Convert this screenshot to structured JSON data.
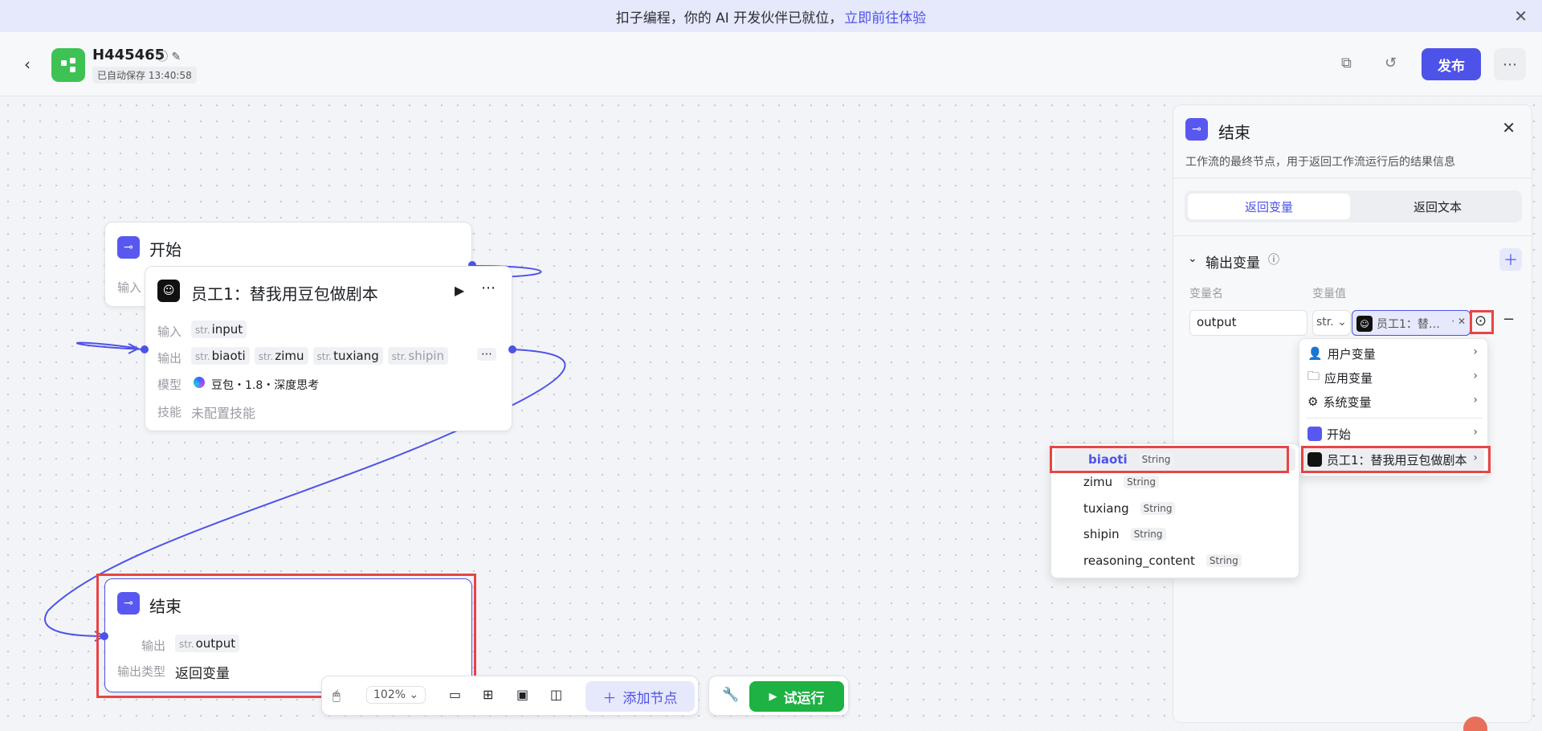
{
  "banner": {
    "text": "扣子编程，你的 AI 开发伙伴已就位，",
    "link": "立即前往体验"
  },
  "header": {
    "title": "H445465",
    "saved": "已自动保存 13:40:58",
    "publish": "发布"
  },
  "nodes": {
    "start": {
      "title": "开始",
      "input_label": "输入"
    },
    "employee": {
      "title": "员工1：替我用豆包做剧本",
      "input_label": "输入",
      "input_var": "input",
      "output_label": "输出",
      "outputs": [
        "biaoti",
        "zimu",
        "tuxiang",
        "shipin"
      ],
      "model_label": "模型",
      "model": "豆包・1.8・深度思考",
      "skill_label": "技能",
      "skill": "未配置技能"
    },
    "end": {
      "title": "结束",
      "output_label": "输出",
      "output_var": "output",
      "type_label": "输出类型",
      "type_value": "返回变量"
    }
  },
  "str_prefix": "str.",
  "toolbar": {
    "zoom": "102%",
    "add_node": "添加节点",
    "run": "试运行"
  },
  "panel": {
    "title": "结束",
    "description": "工作流的最终节点，用于返回工作流运行后的结果信息",
    "tab_vars": "返回变量",
    "tab_text": "返回文本",
    "section": "输出变量",
    "col_name": "变量名",
    "col_value": "变量值",
    "var_name": "output",
    "var_type": "str.",
    "var_ref": "员工1：替…"
  },
  "menu": {
    "user_vars": "用户变量",
    "app_vars": "应用变量",
    "sys_vars": "系统变量",
    "start": "开始",
    "employee": "员工1：替我用豆包做剧本"
  },
  "submenu": [
    {
      "name": "biaoti",
      "type": "String"
    },
    {
      "name": "zimu",
      "type": "String"
    },
    {
      "name": "tuxiang",
      "type": "String"
    },
    {
      "name": "shipin",
      "type": "String"
    },
    {
      "name": "reasoning_content",
      "type": "String"
    }
  ],
  "colors": {
    "accent": "#4d53e8",
    "run": "#1db243",
    "highlight": "#e84545"
  }
}
